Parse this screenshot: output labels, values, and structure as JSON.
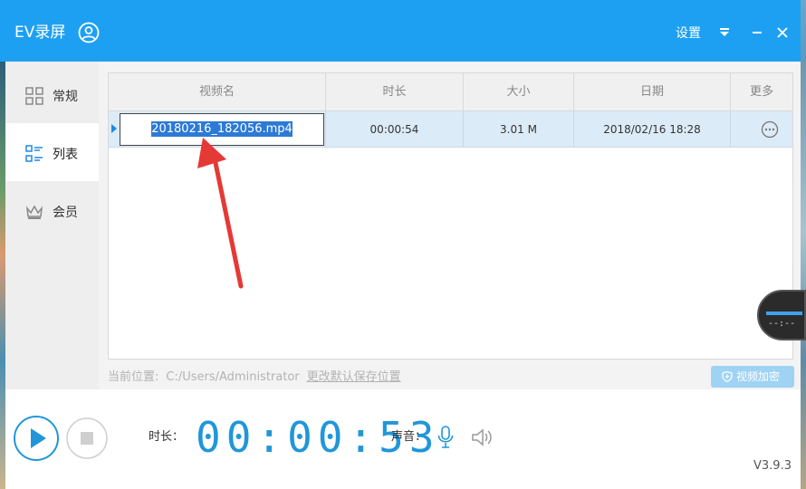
{
  "titlebar": {
    "app_title": "EV录屏",
    "settings_label": "设置"
  },
  "sidebar": {
    "items": [
      {
        "label": "常规",
        "icon": "grid-icon"
      },
      {
        "label": "列表",
        "icon": "list-icon"
      },
      {
        "label": "会员",
        "icon": "crown-icon"
      }
    ]
  },
  "table": {
    "headers": [
      "视频名",
      "时长",
      "大小",
      "日期",
      "更多"
    ],
    "rows": [
      {
        "name": "20180216_182056.mp4",
        "duration": "00:00:54",
        "size": "3.01 M",
        "date": "2018/02/16 18:28"
      }
    ]
  },
  "location": {
    "label": "当前位置:",
    "path": "C:/Users/Administrator",
    "change_link": "更改默认保存位置"
  },
  "encrypt_button": "视频加密",
  "bottom": {
    "duration_label": "时长：",
    "timer": "00:00:53",
    "sound_label": "声音：",
    "version": "V3.9.3"
  },
  "float_widget": {
    "text": "--:--"
  },
  "colors": {
    "accent": "#1ea0f2",
    "timer": "#2196d9",
    "selection": "#2d7ad6",
    "arrow": "#e53935"
  }
}
